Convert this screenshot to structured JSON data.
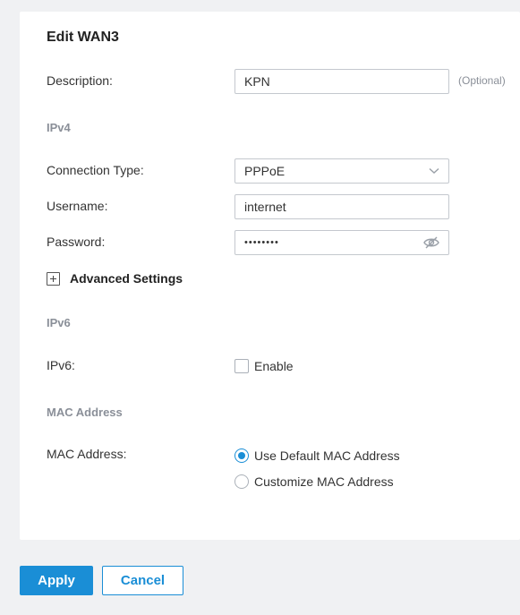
{
  "form": {
    "title": "Edit WAN3",
    "description": {
      "label": "Description:",
      "value": "KPN",
      "hint": "(Optional)"
    },
    "ipv4_section": "IPv4",
    "connection_type": {
      "label": "Connection Type:",
      "value": "PPPoE"
    },
    "username": {
      "label": "Username:",
      "value": "internet"
    },
    "password": {
      "label": "Password:",
      "masked_value": "••••••••"
    },
    "advanced_settings": "Advanced Settings",
    "ipv6_section": "IPv6",
    "ipv6": {
      "label": "IPv6:",
      "checkbox_label": "Enable",
      "checked": false
    },
    "mac_section": "MAC Address",
    "mac": {
      "label": "MAC Address:",
      "options": [
        {
          "label": "Use Default MAC Address",
          "selected": true
        },
        {
          "label": "Customize MAC Address",
          "selected": false
        }
      ]
    }
  },
  "buttons": {
    "apply": "Apply",
    "cancel": "Cancel"
  },
  "colors": {
    "accent": "#1a8ed6",
    "section_text": "#8a8f98",
    "page_bg": "#f0f1f3"
  },
  "icons": {
    "select": "chevron-down-icon",
    "password_toggle": "eye-off-icon",
    "advanced": "plus-square-icon"
  }
}
